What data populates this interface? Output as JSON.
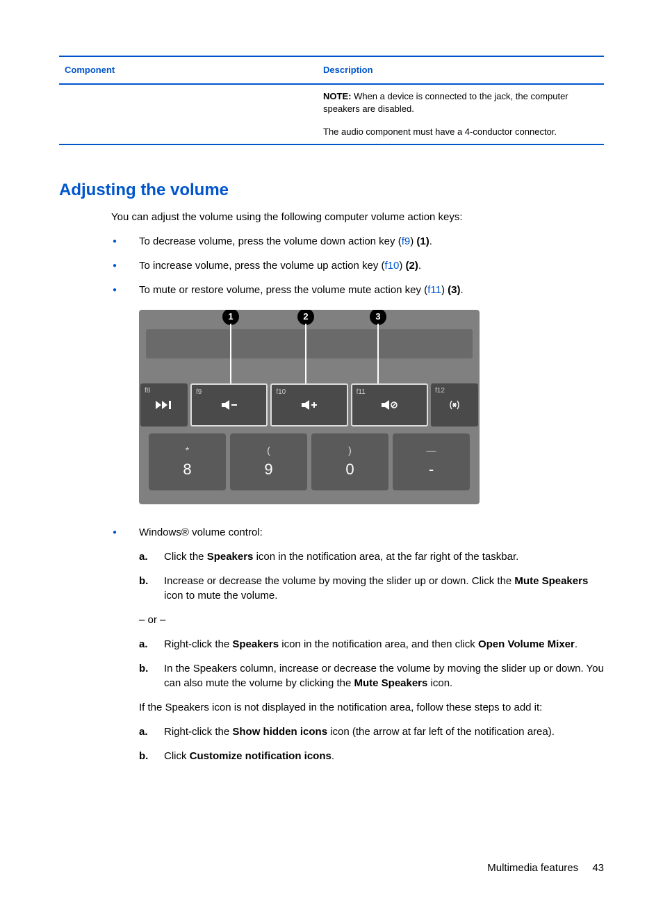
{
  "table": {
    "headers": {
      "component": "Component",
      "description": "Description"
    },
    "note_label": "NOTE:",
    "note_text": "When a device is connected to the jack, the computer speakers are disabled.",
    "audio_text": "The audio component must have a 4-conductor connector."
  },
  "heading": "Adjusting the volume",
  "intro": "You can adjust the volume using the following computer volume action keys:",
  "bullets": {
    "decrease_pre": "To decrease volume, press the volume down action key (",
    "decrease_key": "f9",
    "decrease_post": ") ",
    "decrease_ref": "(1)",
    "increase_pre": "To increase volume, press the volume up action key (",
    "increase_key": "f10",
    "increase_post": ") ",
    "increase_ref": "(2)",
    "mute_pre": "To mute or restore volume, press the volume mute action key (",
    "mute_key": "f11",
    "mute_post": ") ",
    "mute_ref": "(3)",
    "period": "."
  },
  "figure": {
    "callouts": [
      "1",
      "2",
      "3"
    ],
    "fkeys": {
      "f8": "f8",
      "f9": "f9",
      "f10": "f10",
      "f11": "f11",
      "f12": "f12"
    },
    "numrow": [
      {
        "sym": "*",
        "num": "8"
      },
      {
        "sym": "(",
        "num": "9"
      },
      {
        "sym": ")",
        "num": "0"
      },
      {
        "sym": "—",
        "num": "-"
      }
    ]
  },
  "windows_bullet": "Windows® volume control:",
  "steps1": {
    "a_pre": "Click the ",
    "a_bold": "Speakers",
    "a_post": " icon in the notification area, at the far right of the taskbar.",
    "b_pre": "Increase or decrease the volume by moving the slider up or down. Click the ",
    "b_bold": "Mute Speakers",
    "b_post": " icon to mute the volume."
  },
  "or_text": "– or –",
  "steps2": {
    "a_pre": "Right-click the ",
    "a_bold1": "Speakers",
    "a_mid": " icon in the notification area, and then click ",
    "a_bold2": "Open Volume Mixer",
    "a_post": ".",
    "b_pre": "In the Speakers column, increase or decrease the volume by moving the slider up or down. You can also mute the volume by clicking the ",
    "b_bold": "Mute Speakers",
    "b_post": " icon."
  },
  "show_hidden_intro": "If the Speakers icon is not displayed in the notification area, follow these steps to add it:",
  "steps3": {
    "a_pre": "Right-click the ",
    "a_bold": "Show hidden icons",
    "a_post": " icon (the arrow at far left of the notification area).",
    "b_pre": "Click ",
    "b_bold": "Customize notification icons",
    "b_post": "."
  },
  "letters": {
    "a": "a.",
    "b": "b."
  },
  "footer": {
    "section": "Multimedia features",
    "page": "43"
  }
}
